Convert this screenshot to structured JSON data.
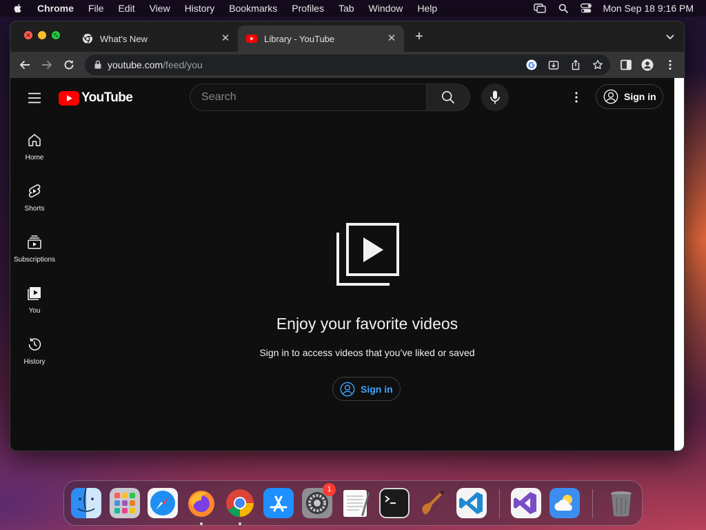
{
  "menubar": {
    "app_name": "Chrome",
    "items": [
      "File",
      "Edit",
      "View",
      "History",
      "Bookmarks",
      "Profiles",
      "Tab",
      "Window",
      "Help"
    ],
    "clock": "Mon Sep 18  9:16 PM"
  },
  "browser": {
    "tabs": [
      {
        "title": "What's New",
        "icon": "chrome-icon",
        "active": false
      },
      {
        "title": "Library - YouTube",
        "icon": "youtube-icon",
        "active": true
      }
    ],
    "url_host": "youtube.com",
    "url_path": "/feed/you"
  },
  "youtube": {
    "logo_text": "YouTube",
    "search_placeholder": "Search",
    "sign_in_label": "Sign in",
    "guide": [
      {
        "label": "Home",
        "icon": "home-icon"
      },
      {
        "label": "Shorts",
        "icon": "shorts-icon"
      },
      {
        "label": "Subscriptions",
        "icon": "subscriptions-icon"
      },
      {
        "label": "You",
        "icon": "you-icon"
      },
      {
        "label": "History",
        "icon": "history-icon"
      }
    ],
    "empty_state": {
      "title": "Enjoy your favorite videos",
      "subtitle": "Sign in to access videos that you’ve liked or saved",
      "button": "Sign in"
    },
    "colors": {
      "brand_red": "#ff0000",
      "link_blue": "#3ea6ff"
    }
  },
  "dock": {
    "apps": [
      "finder",
      "launchpad",
      "safari",
      "firefox",
      "chrome",
      "app-store",
      "system-settings",
      "textedit",
      "terminal",
      "garageband",
      "vscode",
      "visual-studio",
      "weather",
      "trash"
    ],
    "system_settings_badge": "1"
  }
}
